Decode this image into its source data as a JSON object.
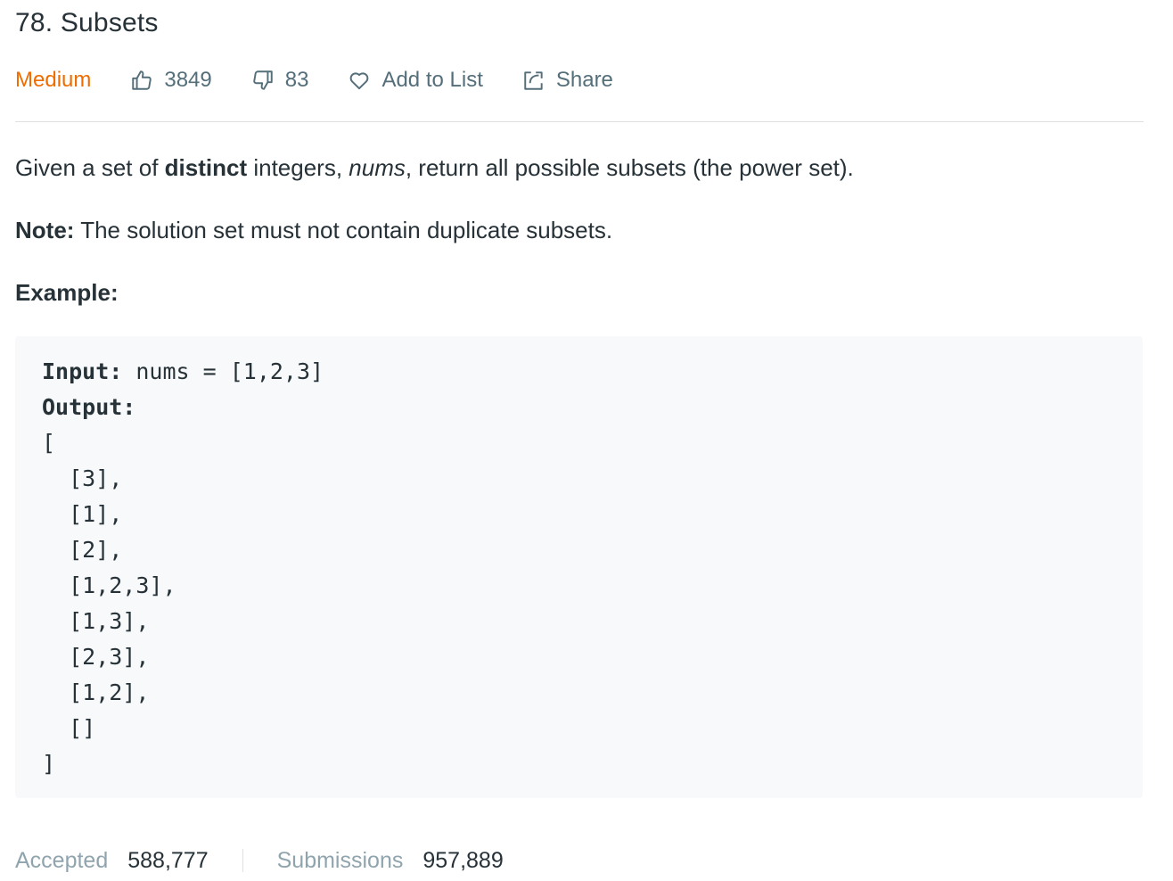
{
  "problem": {
    "title": "78. Subsets",
    "difficulty": "Medium",
    "likes": "3849",
    "dislikes": "83",
    "add_to_list_label": "Add to List",
    "share_label": "Share"
  },
  "description": {
    "intro_before": "Given a set of ",
    "intro_bold": "distinct",
    "intro_middle": " integers, ",
    "intro_italic": "nums",
    "intro_after": ", return all possible subsets (the power set).",
    "note_label": "Note:",
    "note_text": " The solution set must not contain duplicate subsets.",
    "example_label": "Example:"
  },
  "example": {
    "input_label": "Input:",
    "input_value": " nums = [1,2,3]",
    "output_label": "Output:",
    "output_lines": [
      "[",
      "  [3],",
      "  [1],",
      "  [2],",
      "  [1,2,3],",
      "  [1,3],",
      "  [2,3],",
      "  [1,2],",
      "  []",
      "]"
    ]
  },
  "stats": {
    "accepted_label": "Accepted",
    "accepted_value": "588,777",
    "submissions_label": "Submissions",
    "submissions_value": "957,889"
  },
  "colors": {
    "difficulty_medium": "#ef6c00",
    "text_primary": "#263238",
    "text_secondary": "#546e7a",
    "text_muted": "#90a4ae",
    "code_bg": "#f7f9fa"
  }
}
